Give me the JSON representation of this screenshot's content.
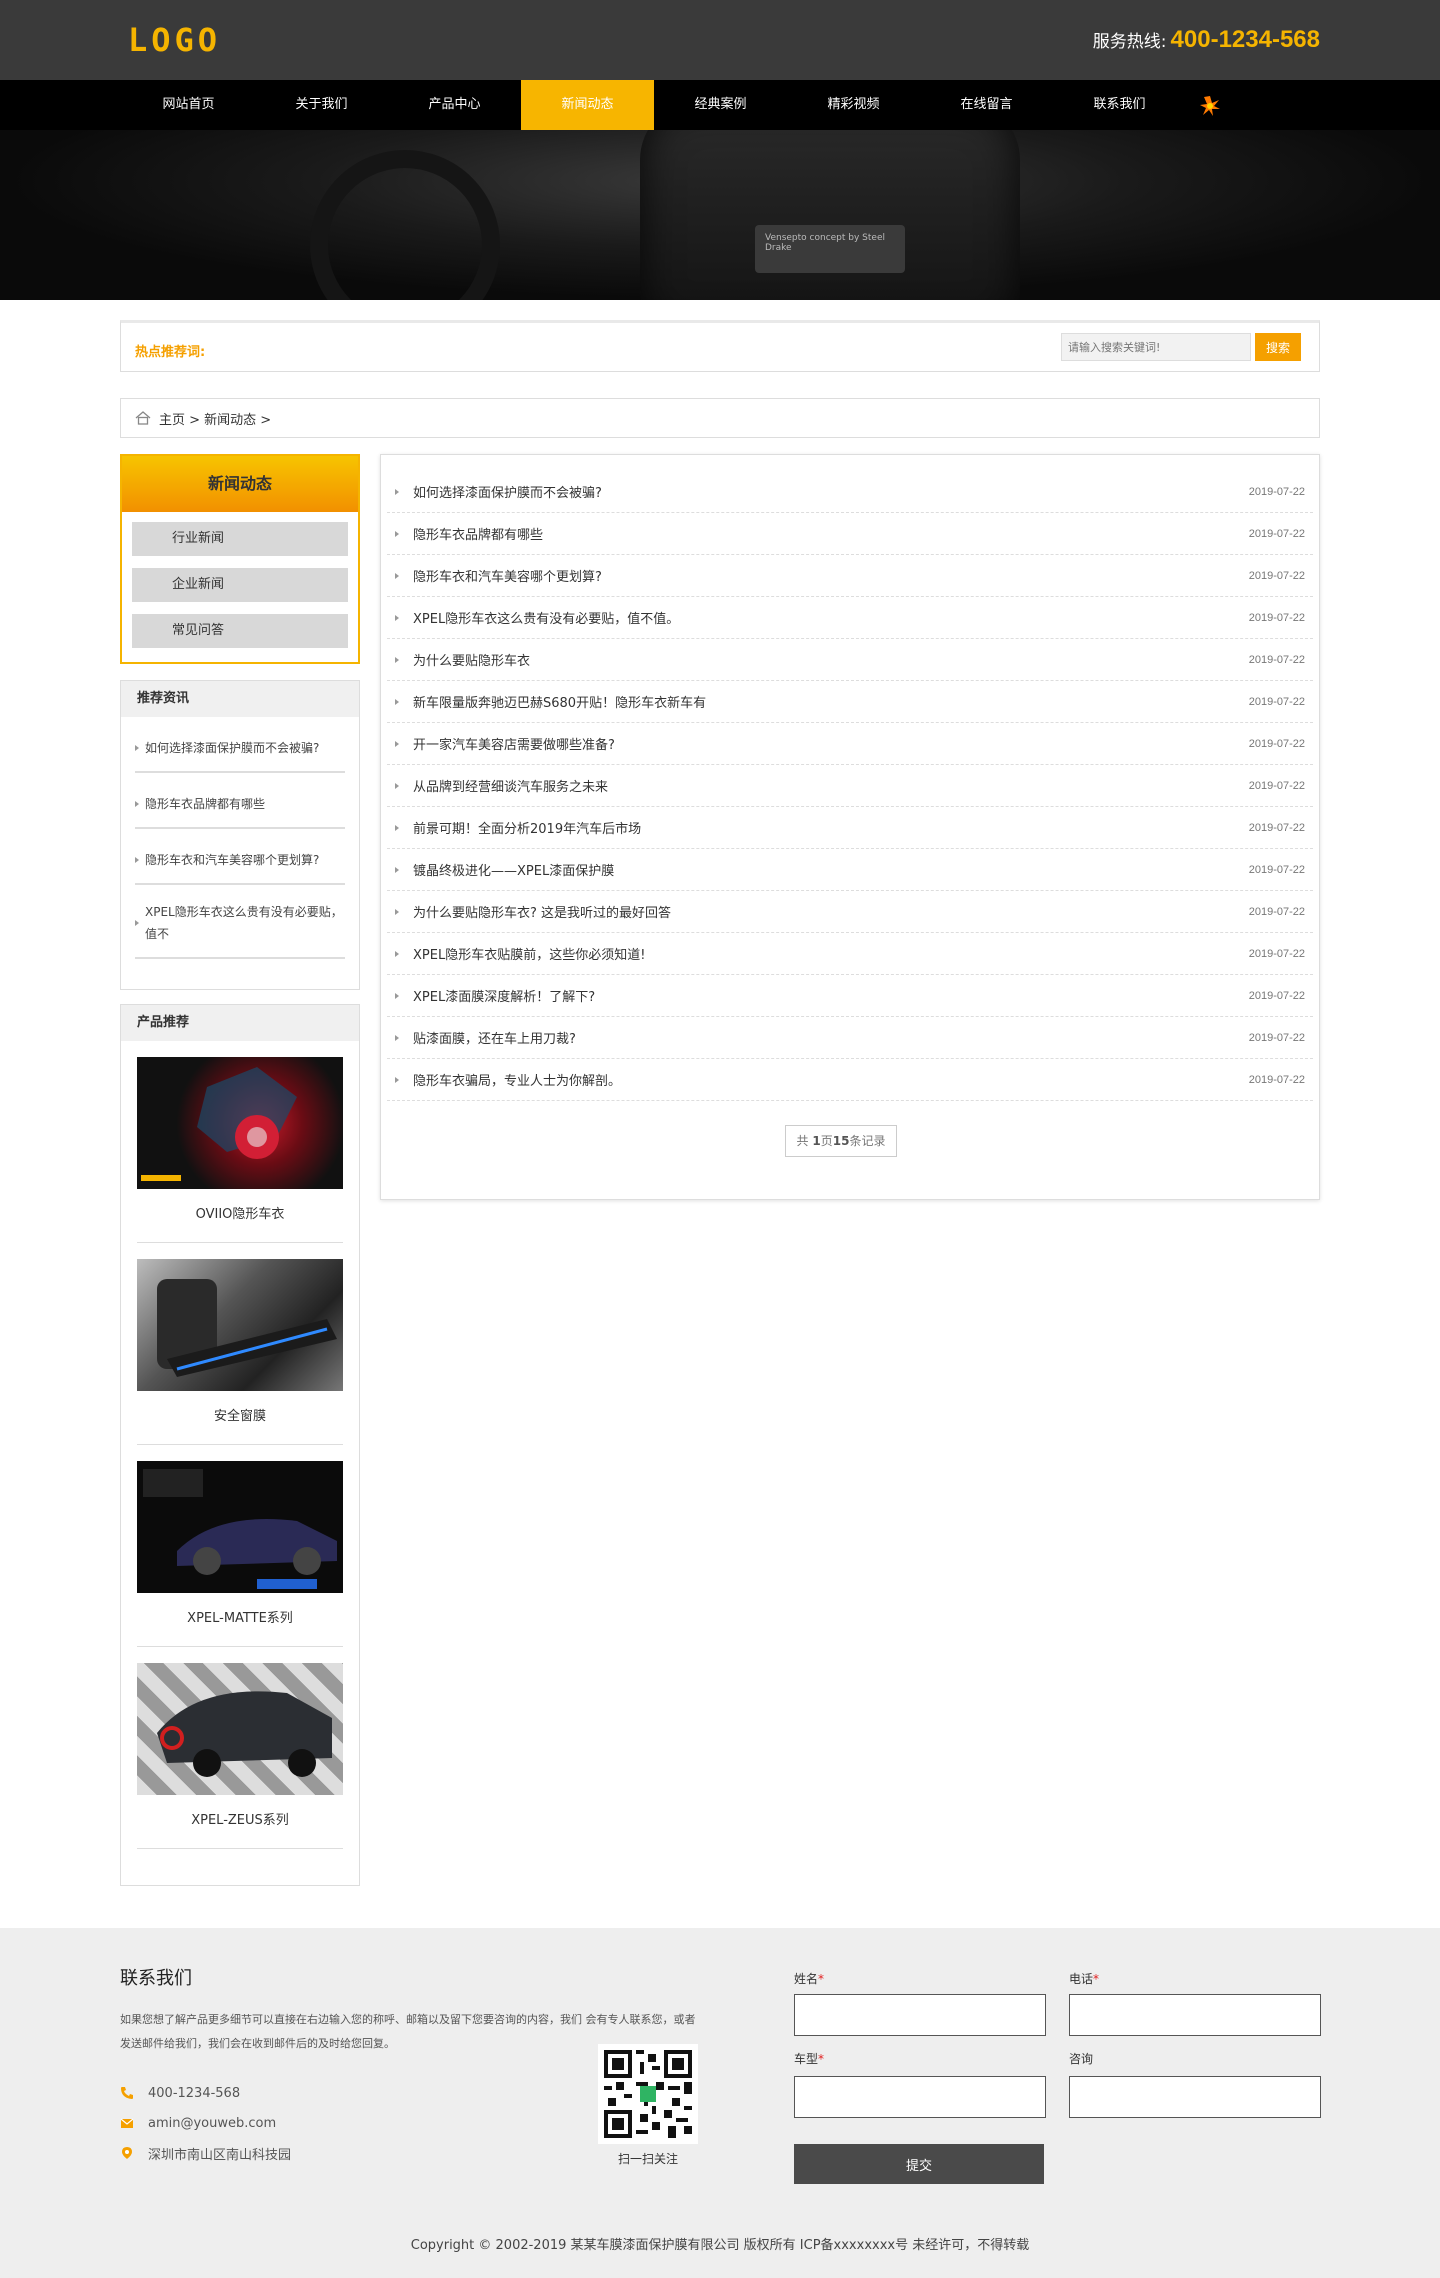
{
  "header": {
    "logo": "LOGO",
    "hotline_label": "服务热线:",
    "hotline_number": "400-1234-568"
  },
  "nav": [
    "网站首页",
    "关于我们",
    "产品中心",
    "新闻动态",
    "经典案例",
    "精彩视频",
    "在线留言",
    "联系我们"
  ],
  "banner": {
    "plate_text": "Vensepto concept by Steel Drake"
  },
  "search": {
    "hot_label": "热点推荐词:",
    "placeholder": "请输入搜索关键词!",
    "button": "搜索"
  },
  "breadcrumb": "主页 > 新闻动态 >",
  "sidebar": {
    "title": "新闻动态",
    "items": [
      "行业新闻",
      "企业新闻",
      "常见问答"
    ]
  },
  "recommend": {
    "title": "推荐资讯",
    "items": [
      "如何选择漆面保护膜而不会被骗?",
      "隐形车衣品牌都有哪些",
      "隐形车衣和汽车美容哪个更划算?",
      "XPEL隐形车衣这么贵有没有必要贴，值不"
    ]
  },
  "products": {
    "title": "产品推荐",
    "items": [
      "OVIIO隐形车衣",
      "安全窗膜",
      "XPEL-MATTE系列",
      "XPEL-ZEUS系列"
    ]
  },
  "news": [
    {
      "title": "如何选择漆面保护膜而不会被骗?",
      "date": "2019-07-22"
    },
    {
      "title": "隐形车衣品牌都有哪些",
      "date": "2019-07-22"
    },
    {
      "title": "隐形车衣和汽车美容哪个更划算?",
      "date": "2019-07-22"
    },
    {
      "title": "XPEL隐形车衣这么贵有没有必要贴，值不值。",
      "date": "2019-07-22"
    },
    {
      "title": "为什么要贴隐形车衣",
      "date": "2019-07-22"
    },
    {
      "title": "新车限量版奔驰迈巴赫S680开贴！隐形车衣新车有",
      "date": "2019-07-22"
    },
    {
      "title": "开一家汽车美容店需要做哪些准备?",
      "date": "2019-07-22"
    },
    {
      "title": "从品牌到经营细谈汽车服务之未来",
      "date": "2019-07-22"
    },
    {
      "title": "前景可期！全面分析2019年汽车后市场",
      "date": "2019-07-22"
    },
    {
      "title": "镀晶终极进化——XPEL漆面保护膜",
      "date": "2019-07-22"
    },
    {
      "title": "为什么要贴隐形车衣? 这是我听过的最好回答",
      "date": "2019-07-22"
    },
    {
      "title": "XPEL隐形车衣贴膜前，这些你必须知道!",
      "date": "2019-07-22"
    },
    {
      "title": "XPEL漆面膜深度解析！了解下?",
      "date": "2019-07-22"
    },
    {
      "title": "贴漆面膜，还在车上用刀裁?",
      "date": "2019-07-22"
    },
    {
      "title": "隐形车衣骗局，专业人士为你解剖。",
      "date": "2019-07-22"
    }
  ],
  "pager": {
    "pre": "共 ",
    "pages": "1",
    "mid": "页",
    "count": "15",
    "post": "条记录"
  },
  "footer": {
    "title": "联系我们",
    "desc": "如果您想了解产品更多细节可以直接在右边输入您的称呼、邮箱以及留下您要咨询的内容，我们 会有专人联系您，或者发送邮件给我们，我们会在收到邮件后的及时给您回复。",
    "phone": "400-1234-568",
    "email": "amin@youweb.com",
    "address": "深圳市南山区南山科技园",
    "qr_label": "扫一扫关注",
    "form": {
      "name_label": "姓名",
      "phone_label": "电话",
      "car_label": "车型",
      "consult_label": "咨询",
      "required_mark": "*",
      "submit": "提交"
    },
    "copyright": "Copyright © 2002-2019 某某车膜漆面保护膜有限公司 版权所有 ICP备xxxxxxxx号 未经许可，不得转载"
  },
  "colors": {
    "accent": "#f5b400",
    "accent_dark": "#f29000",
    "header_bg": "#3a3a3a",
    "nav_bg": "#000000"
  }
}
